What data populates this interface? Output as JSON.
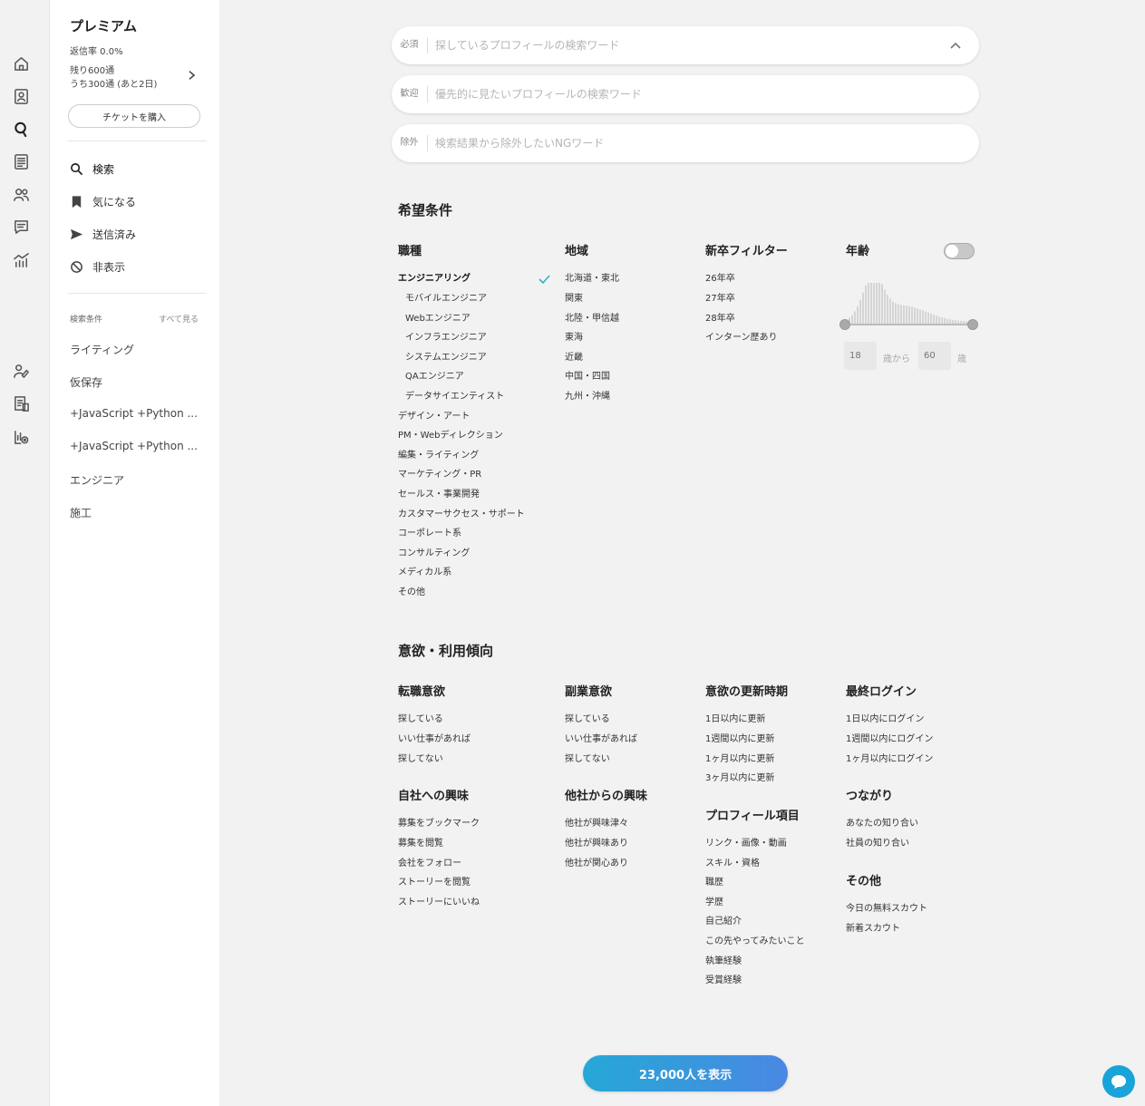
{
  "plan": {
    "title": "プレミアム",
    "reply_rate": "返信率 0.0%",
    "remaining": "残り600通",
    "remaining_sub": "うち300通 (あと2日)",
    "ticket_button": "チケットを購入"
  },
  "nav": {
    "search": "検索",
    "bookmarks": "気になる",
    "sent": "送信済み",
    "hidden": "非表示"
  },
  "saved_conditions": {
    "heading": "検索条件",
    "see_all": "すべて見る",
    "items": [
      "ライティング",
      "仮保存",
      "+JavaScript +Python ...",
      "+JavaScript +Python ...",
      "エンジニア",
      "施工"
    ]
  },
  "search": {
    "required_tag": "必須",
    "required_placeholder": "探しているプロフィールの検索ワード",
    "welcome_tag": "歓迎",
    "welcome_placeholder": "優先的に見たいプロフィールの検索ワード",
    "exclude_tag": "除外",
    "exclude_placeholder": "検索結果から除外したいNGワード"
  },
  "conditions": {
    "title": "希望条件",
    "job": {
      "title": "職種",
      "items": [
        "エンジニアリング",
        "モバイルエンジニア",
        "Webエンジニア",
        "インフラエンジニア",
        "システムエンジニア",
        "QAエンジニア",
        "データサイエンティスト",
        "デザイン・アート",
        "PM・Webディレクション",
        "編集・ライティング",
        "マーケティング・PR",
        "セールス・事業開発",
        "カスタマーサクセス・サポート",
        "コーポレート系",
        "コンサルティング",
        "メディカル系",
        "その他"
      ]
    },
    "region": {
      "title": "地域",
      "items": [
        "北海道・東北",
        "関東",
        "北陸・甲信越",
        "東海",
        "近畿",
        "中国・四国",
        "九州・沖縄"
      ]
    },
    "new_grad": {
      "title": "新卒フィルター",
      "items": [
        "26年卒",
        "27年卒",
        "28年卒",
        "インターン歴あり"
      ]
    },
    "age": {
      "title": "年齢",
      "min_placeholder": "18",
      "max_placeholder": "60",
      "from_label": "歳から",
      "to_label": "歳",
      "enabled": false
    }
  },
  "motivation": {
    "title": "意欲・利用傾向",
    "job_change": {
      "title": "転職意欲",
      "items": [
        "探している",
        "いい仕事があれば",
        "探してない"
      ]
    },
    "side_job": {
      "title": "副業意欲",
      "items": [
        "探している",
        "いい仕事があれば",
        "探してない"
      ]
    },
    "update": {
      "title": "意欲の更新時期",
      "items": [
        "1日以内に更新",
        "1週間以内に更新",
        "1ヶ月以内に更新",
        "3ヶ月以内に更新"
      ]
    },
    "login": {
      "title": "最終ログイン",
      "items": [
        "1日以内にログイン",
        "1週間以内にログイン",
        "1ヶ月以内にログイン"
      ]
    },
    "own_interest": {
      "title": "自社への興味",
      "items": [
        "募集をブックマーク",
        "募集を閲覧",
        "会社をフォロー",
        "ストーリーを閲覧",
        "ストーリーにいいね"
      ]
    },
    "other_interest": {
      "title": "他社からの興味",
      "items": [
        "他社が興味津々",
        "他社が興味あり",
        "他社が関心あり"
      ]
    },
    "profile": {
      "title": "プロフィール項目",
      "items": [
        "リンク・画像・動画",
        "スキル・資格",
        "職歴",
        "学歴",
        "自己紹介",
        "この先やってみたいこと",
        "執筆経験",
        "受賞経験"
      ]
    },
    "connection": {
      "title": "つながり",
      "items": [
        "あなたの知り合い",
        "社員の知り合い"
      ]
    },
    "other": {
      "title": "その他",
      "items": [
        "今日の無料スカウト",
        "新着スカウト"
      ]
    }
  },
  "show_button": "23,000人を表示",
  "colors": {
    "accent": "#2bb3c8",
    "button_start": "#25a8d6",
    "button_end": "#4a88e3"
  }
}
